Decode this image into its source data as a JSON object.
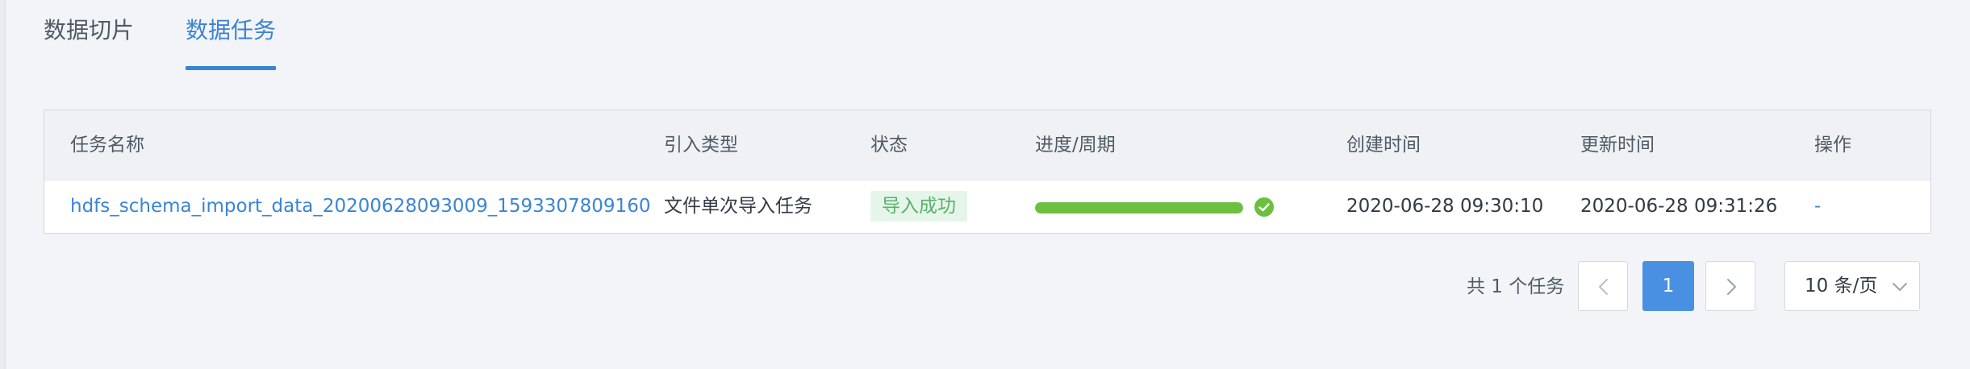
{
  "tabs": [
    {
      "label": "数据切片",
      "active": false
    },
    {
      "label": "数据任务",
      "active": true
    }
  ],
  "table": {
    "columns": [
      "任务名称",
      "引入类型",
      "状态",
      "进度/周期",
      "创建时间",
      "更新时间",
      "操作"
    ],
    "rows": [
      {
        "name": "hdfs_schema_import_data_20200628093009_1593307809160",
        "type": "文件单次导入任务",
        "status": "导入成功",
        "progress": 1.0,
        "created": "2020-06-28 09:30:10",
        "updated": "2020-06-28 09:31:26",
        "action": "-"
      }
    ]
  },
  "pagination": {
    "total_text": "共 1 个任务",
    "current_page": "1",
    "page_size": "10 条/页"
  },
  "colors": {
    "accent": "#3b84d4",
    "success_bg": "#e6f5ea",
    "success_text": "#58b06a",
    "progress": "#6cc040"
  },
  "icons": {
    "status_done": "check-circle-icon",
    "prev": "chevron-left-icon",
    "next": "chevron-right-icon",
    "dropdown": "chevron-down-icon"
  }
}
